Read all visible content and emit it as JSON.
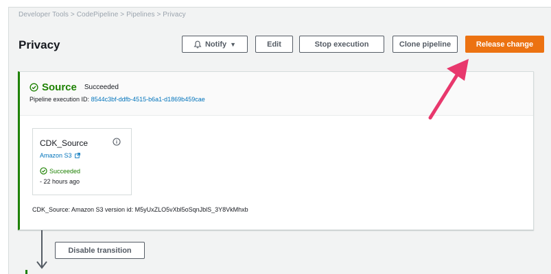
{
  "breadcrumb": "Developer Tools > CodePipeline > Pipelines > Privacy",
  "page_title": "Privacy",
  "toolbar": {
    "notify_label": "Notify",
    "edit_label": "Edit",
    "stop_label": "Stop execution",
    "clone_label": "Clone pipeline",
    "release_label": "Release change"
  },
  "stage": {
    "name": "Source",
    "status": "Succeeded",
    "execution_label": "Pipeline execution ID:",
    "execution_id": "8544c3bf-ddfb-4515-b6a1-d1869b459cae",
    "action": {
      "name": "CDK_Source",
      "provider": "Amazon S3",
      "status": "Succeeded",
      "time": "- 22 hours ago"
    },
    "version_line": "CDK_Source: Amazon S3 version id: M5yUxZLO5vXbl5oSqnJblS_3Y8VkMhxb"
  },
  "transition": {
    "disable_label": "Disable transition"
  },
  "colors": {
    "success": "#1d8102",
    "primary": "#ec7211",
    "link": "#0073bb",
    "annotation": "#e8386d"
  },
  "icons": {
    "notify": "bell-icon",
    "caret": "caret-down-icon",
    "status": "check-circle-icon",
    "info": "info-icon",
    "external": "external-link-icon",
    "transition": "down-arrow-icon"
  }
}
